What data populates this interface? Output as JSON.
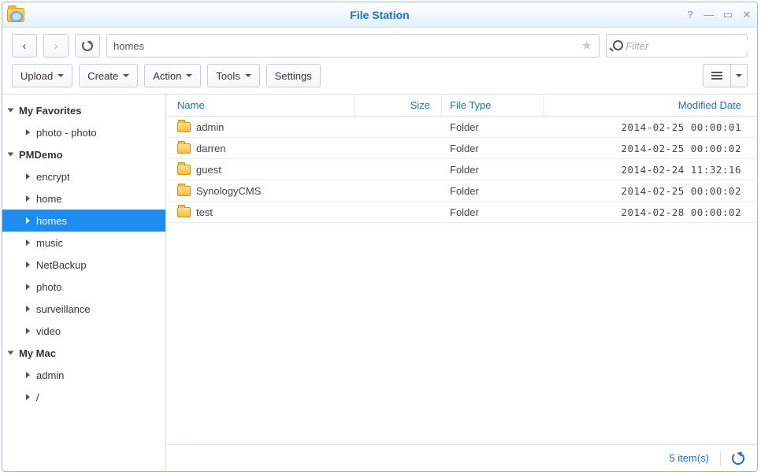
{
  "window": {
    "title": "File Station"
  },
  "toolbar": {
    "path": "homes",
    "filter_placeholder": "Filter"
  },
  "actions": {
    "upload": "Upload",
    "create": "Create",
    "action": "Action",
    "tools": "Tools",
    "settings": "Settings"
  },
  "sidebar": {
    "favorites_label": "My Favorites",
    "favorites": [
      "photo - photo"
    ],
    "shares_label": "PMDemo",
    "shares": [
      "encrypt",
      "home",
      "homes",
      "music",
      "NetBackup",
      "photo",
      "surveillance",
      "video"
    ],
    "selected": "homes",
    "mac_label": "My Mac",
    "mac": [
      "admin",
      "/"
    ]
  },
  "columns": {
    "name": "Name",
    "size": "Size",
    "type": "File Type",
    "date": "Modified Date"
  },
  "files": [
    {
      "name": "admin",
      "type": "Folder",
      "date": "2014-02-25 00:00:01"
    },
    {
      "name": "darren",
      "type": "Folder",
      "date": "2014-02-25 00:00:02"
    },
    {
      "name": "guest",
      "type": "Folder",
      "date": "2014-02-24 11:32:16"
    },
    {
      "name": "SynologyCMS",
      "type": "Folder",
      "date": "2014-02-25 00:00:02"
    },
    {
      "name": "test",
      "type": "Folder",
      "date": "2014-02-28 00:00:02"
    }
  ],
  "status": {
    "count_text": "5 item(s)"
  }
}
